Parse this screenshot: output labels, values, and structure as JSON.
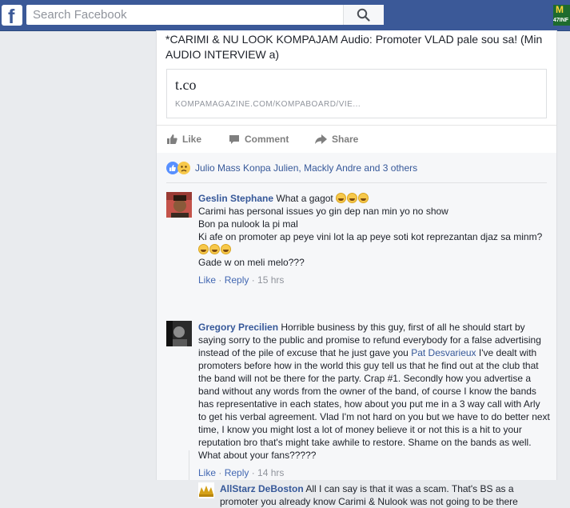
{
  "header": {
    "logo": "f",
    "search_placeholder": "Search Facebook",
    "search_icon": "search-icon",
    "corner_badge_line1": "M",
    "corner_badge_line2": "47INF"
  },
  "post": {
    "text": "*CARIMI & NU LOOK KOMPAJAM Audio: Promoter VLAD pale sou sa! (Min AUDIO INTERVIEW a)",
    "link_title": "t.co",
    "link_domain": "KOMPAMAGAZINE.COM/KOMPABOARD/VIE..."
  },
  "actions": {
    "like": "Like",
    "comment": "Comment",
    "share": "Share"
  },
  "reactions": {
    "text": "Julio Mass Konpa Julien, Mackly Andre and 3 others"
  },
  "comments": [
    {
      "author": "Geslin Stephane",
      "line1": "What a gagot",
      "line2": "Carimi has personal issues yo gin dep nan min yo no show",
      "line3": "Bon pa nulook la pi mal",
      "line4": "Ki afe on promoter ap peye vini lot la ap peye soti kot reprezantan djaz sa minm?",
      "line5": "Gade w on meli melo???",
      "like": "Like",
      "reply": "Reply",
      "time": "15 hrs"
    },
    {
      "author": "Gregory Precilien",
      "text_before": "Horrible business by this guy, first of all he should start by saying sorry to the public and promise to refund everybody for a false advertising instead of the pile of excuse that he just gave you",
      "mention": "Pat Desvarieux",
      "text_after": "I've dealt with promoters before how in the world this guy tell us that he find out at the club that the band will not be there for the party. Crap #1. Secondly how you advertise a band without any words from the owner of the band, of course I know the bands has representative in each states, how about you put me in a 3 way call with Arly to get his verbal agreement. Vlad I'm not hard on you but we have to do better next time, I know you might lost a lot of money believe it or not this is a hit to your reputation bro that's might take awhile to restore. Shame on the bands as well. What about your fans?????",
      "like": "Like",
      "reply": "Reply",
      "time": "14 hrs"
    },
    {
      "author": "AllStarz DeBoston",
      "text": "All I can say is that it was a scam. That's BS as a promoter you already know Carimi & Nulook was not going to be there"
    }
  ],
  "colors": {
    "topbar": "#3b5998",
    "link": "#365899",
    "muted": "#90949c"
  }
}
